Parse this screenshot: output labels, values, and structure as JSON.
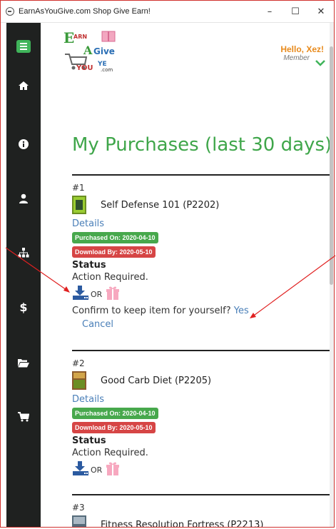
{
  "window": {
    "title": "EarnAsYouGive.com Shop Give Earn!",
    "min_glyph": "–",
    "max_glyph": "☐",
    "close_glyph": "✕"
  },
  "sidebar": {
    "items": [
      {
        "icon": "home-icon"
      },
      {
        "icon": "info-icon"
      },
      {
        "icon": "user-icon"
      },
      {
        "icon": "sitemap-icon"
      },
      {
        "icon": "dollar-icon"
      },
      {
        "icon": "folder-open-icon"
      },
      {
        "icon": "cart-icon"
      }
    ],
    "accent": "#3fb45a"
  },
  "header": {
    "logo_text_top": "ARN",
    "logo_text_mid": "Give",
    "logo_text_you": "YOU",
    "logo_suffix": ".com",
    "greeting": "Hello, Xez!",
    "role": "Member"
  },
  "page": {
    "title": "My Purchases (last 30 days)",
    "title_color": "#3fa64a"
  },
  "purchases": [
    {
      "number": "#1",
      "product": "Self Defense 101 (P2202)",
      "details": "Details",
      "purchased_on": "Purchased On: 2020-04-10",
      "download_by": "Download By: 2020-05-10",
      "status_heading": "Status",
      "status": "Action Required.",
      "or": "OR",
      "confirm_text": "Confirm to keep item for yourself?",
      "yes": "Yes",
      "cancel": "Cancel"
    },
    {
      "number": "#2",
      "product": "Good Carb Diet (P2205)",
      "details": "Details",
      "purchased_on": "Purchased On: 2020-04-10",
      "download_by": "Download By: 2020-05-10",
      "status_heading": "Status",
      "status": "Action Required.",
      "or": "OR"
    },
    {
      "number": "#3",
      "product": "Fitness Resolution Fortress (P2213)"
    }
  ]
}
